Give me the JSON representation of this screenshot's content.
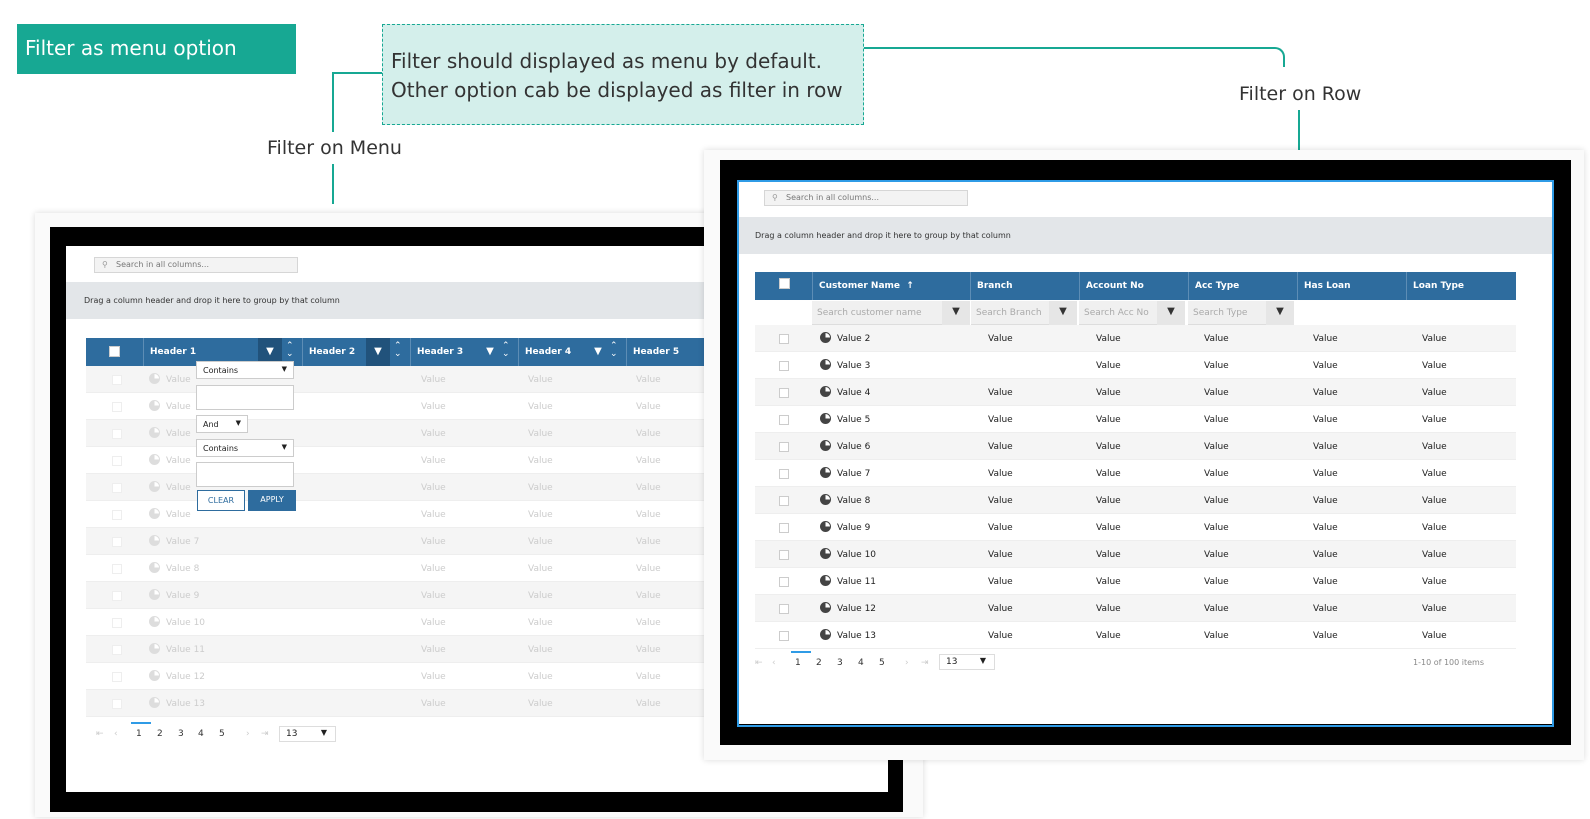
{
  "title_badge": "Filter as menu option",
  "note": {
    "line1": "Filter should displayed as menu by default.",
    "line2": "Other option cab be displayed as filter in row"
  },
  "callouts": {
    "menu": "Filter on Menu",
    "row": "Filter on Row"
  },
  "left_grid": {
    "search_placeholder": "Search in all columns...",
    "group_panel": "Drag a column header and drop it here to group by that column",
    "headers": [
      "Header 1",
      "Header 2",
      "Header 3",
      "Header 4",
      "Header 5"
    ],
    "rows": [
      "Value",
      "Value",
      "Value",
      "Value",
      "Value",
      "Value",
      "Value 7",
      "Value 8",
      "Value 9",
      "Value 10",
      "Value 11",
      "Value 12",
      "Value 13"
    ],
    "cell_value": "Value",
    "filter_menu": {
      "operator1": "Contains",
      "logic": "And",
      "operator2": "Contains",
      "clear": "CLEAR",
      "apply": "APPLY"
    },
    "pager": {
      "pages": [
        "1",
        "2",
        "3",
        "4",
        "5"
      ],
      "page_size": "13"
    }
  },
  "right_grid": {
    "search_placeholder": "Search in all columns...",
    "group_panel": "Drag a column header and drop it here to group by that column",
    "headers": [
      "Customer Name",
      "Branch",
      "Account No",
      "Acc Type",
      "Has Loan",
      "Loan Type"
    ],
    "filter_placeholders": [
      "Search customer name",
      "Search Branch",
      "Search Acc No",
      "Search Type"
    ],
    "rows": [
      "Value 2",
      "Value 3",
      "Value 4",
      "Value 5",
      "Value 6",
      "Value 7",
      "Value 8",
      "Value 9",
      "Value 10",
      "Value 11",
      "Value 12",
      "Value 13"
    ],
    "cell_value": "Value",
    "pager": {
      "pages": [
        "1",
        "2",
        "3",
        "4",
        "5"
      ],
      "page_size": "13",
      "summary": "1-10 of 100 items"
    }
  },
  "colors": {
    "accent": "#17a893",
    "header": "#2e6c9e",
    "selection": "#2f9be6"
  },
  "icons": [
    "search-icon",
    "filter-icon",
    "sort-icon",
    "pie-icon",
    "chevron-down-icon",
    "first-page-icon",
    "prev-page-icon",
    "next-page-icon",
    "last-page-icon",
    "sort-ascending-icon"
  ]
}
